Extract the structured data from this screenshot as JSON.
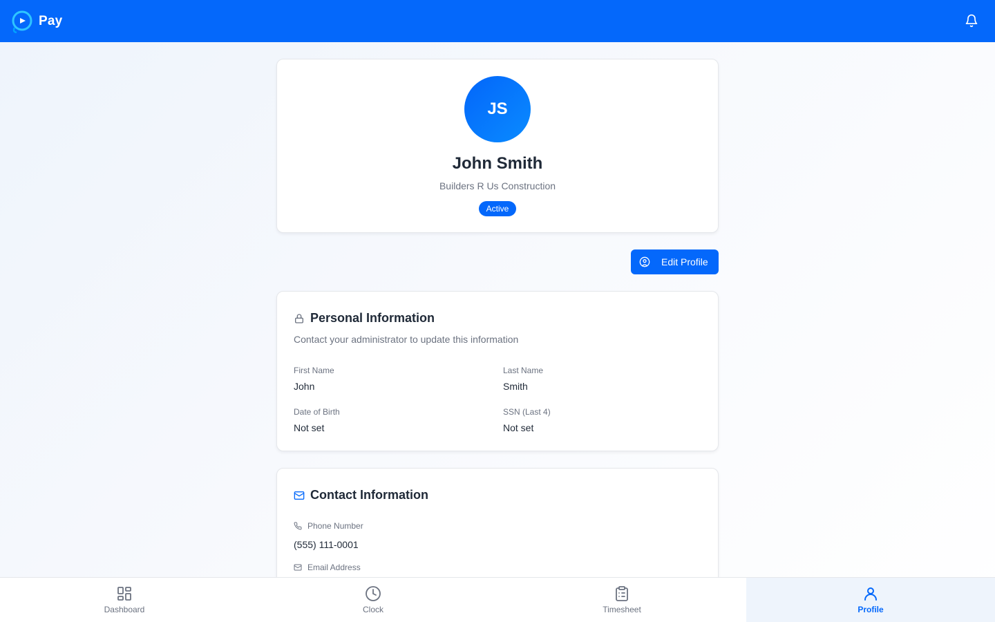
{
  "header": {
    "app_name": "Pay"
  },
  "profile": {
    "initials": "JS",
    "name": "John Smith",
    "company": "Builders R Us Construction",
    "status": "Active",
    "edit_label": "Edit Profile"
  },
  "personal": {
    "title": "Personal Information",
    "subtitle": "Contact your administrator to update this information",
    "fields": [
      {
        "label": "First Name",
        "value": "John"
      },
      {
        "label": "Last Name",
        "value": "Smith"
      },
      {
        "label": "Date of Birth",
        "value": "Not set"
      },
      {
        "label": "SSN (Last 4)",
        "value": "Not set"
      }
    ]
  },
  "contact": {
    "title": "Contact Information",
    "fields": [
      {
        "label": "Phone Number",
        "value": "(555) 111-0001",
        "icon": "phone-icon"
      },
      {
        "label": "Email Address",
        "value": "",
        "icon": "mail-icon"
      }
    ]
  },
  "nav": {
    "items": [
      {
        "label": "Dashboard",
        "icon": "dashboard-icon"
      },
      {
        "label": "Clock",
        "icon": "clock-icon"
      },
      {
        "label": "Timesheet",
        "icon": "clipboard-icon"
      },
      {
        "label": "Profile",
        "icon": "user-icon",
        "active": true
      }
    ]
  },
  "colors": {
    "accent": "#0468fb",
    "text": "#1f2937",
    "muted": "#6b7280"
  }
}
